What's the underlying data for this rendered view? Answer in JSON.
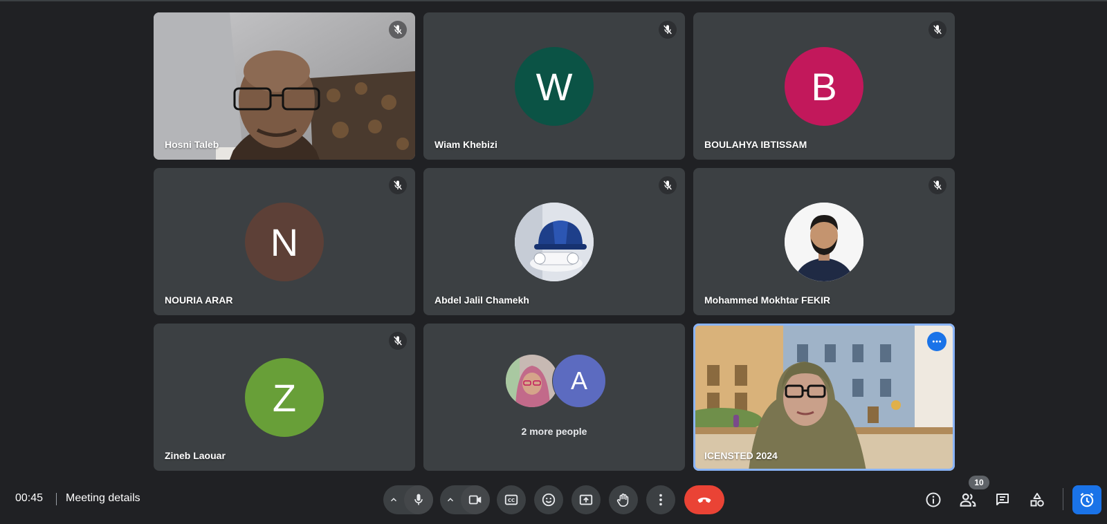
{
  "participants": [
    {
      "name": "Hosni Taleb",
      "type": "video",
      "muted": true
    },
    {
      "name": "Wiam Khebizi",
      "type": "initial",
      "initial": "W",
      "color": "#0b5345",
      "muted": true
    },
    {
      "name": "BOULAHYA IBTISSAM",
      "type": "initial",
      "initial": "B",
      "color": "#c2185b",
      "muted": true
    },
    {
      "name": "NOURIA ARAR",
      "type": "initial",
      "initial": "N",
      "color": "#5d4037",
      "muted": true
    },
    {
      "name": "Abdel Jalil Chamekh",
      "type": "photo",
      "muted": true
    },
    {
      "name": "Mohammed Mokhtar FEKIR",
      "type": "photo",
      "muted": true
    },
    {
      "name": "Zineb Laouar",
      "type": "initial",
      "initial": "Z",
      "color": "#689f38",
      "muted": true
    },
    {
      "type": "overflow",
      "label": "2 more people",
      "second_initial": "A",
      "second_color": "#5c6bc0"
    },
    {
      "name": "ICENSTED 2024",
      "type": "video",
      "self": true,
      "muted": false
    }
  ],
  "bottom_bar": {
    "time": "00:45",
    "meeting_details": "Meeting details",
    "people_count": "10"
  },
  "icons": {
    "mic": "mic-icon",
    "camera": "camera-icon",
    "captions": "captions-icon",
    "emoji": "emoji-icon",
    "present": "present-icon",
    "raise_hand": "hand-icon",
    "more": "more-vert-icon",
    "hangup": "call-end-icon",
    "info": "info-icon",
    "people": "people-icon",
    "chat": "chat-icon",
    "activities": "activities-icon",
    "timer": "alarm-icon"
  },
  "colors": {
    "background": "#202124",
    "tile": "#3c4043",
    "hangup": "#ea4335",
    "accent": "#1a73e8"
  }
}
